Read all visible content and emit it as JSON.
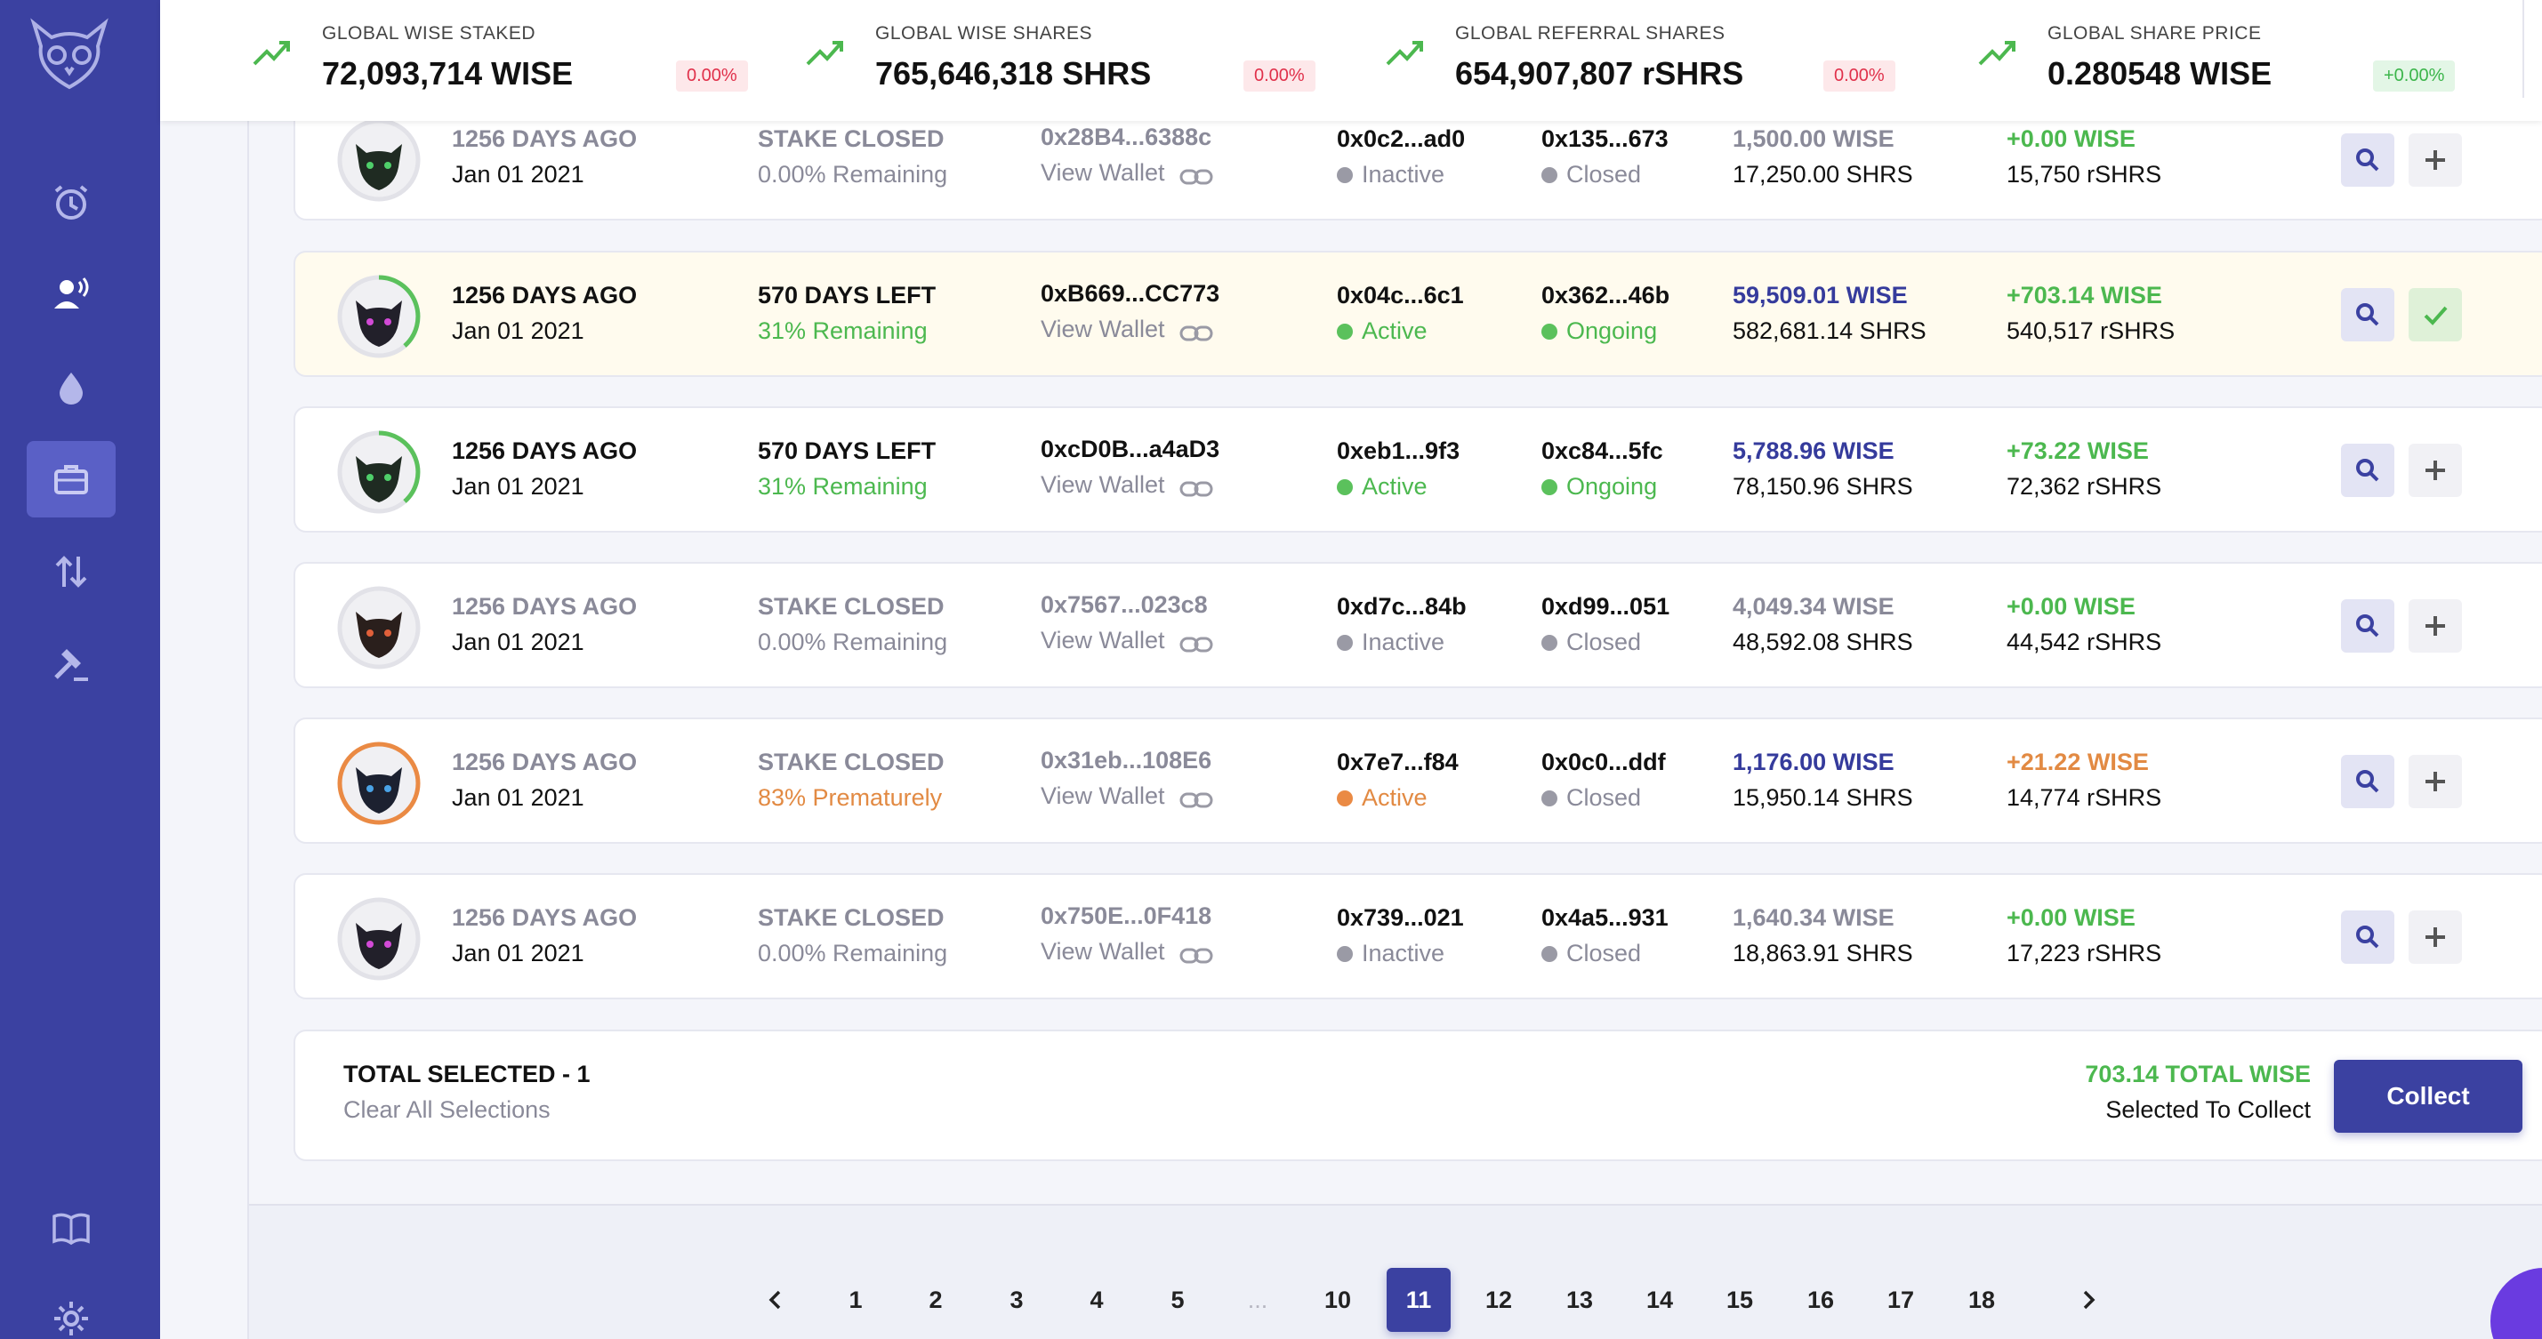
{
  "topbar": {
    "stats": [
      {
        "label": "GLOBAL WISE STAKED",
        "value": "72,093,714 WISE",
        "badge": "0.00%",
        "badge_color": "red"
      },
      {
        "label": "GLOBAL WISE SHARES",
        "value": "765,646,318 SHRS",
        "badge": "0.00%",
        "badge_color": "red"
      },
      {
        "label": "GLOBAL REFERRAL SHARES",
        "value": "654,907,807 rSHRS",
        "badge": "0.00%",
        "badge_color": "red"
      },
      {
        "label": "GLOBAL SHARE PRICE",
        "value": "0.280548 WISE",
        "badge": "+0.00%",
        "badge_color": "green"
      }
    ]
  },
  "sidebar": {
    "items": [
      {
        "icon": "alarm-clock-icon"
      },
      {
        "icon": "referral-voice-icon"
      },
      {
        "icon": "drop-icon"
      },
      {
        "icon": "briefcase-icon",
        "active": true
      },
      {
        "icon": "exchange-arrows-icon"
      },
      {
        "icon": "gavel-icon"
      },
      {
        "icon": "book-icon"
      },
      {
        "icon": "gear-icon"
      }
    ]
  },
  "rows": [
    {
      "ago": "1256 DAYS AGO",
      "date": "Jan 01 2021",
      "status": "STAKE CLOSED",
      "remaining": "0.00% Remaining",
      "wallet": "0x28B4...6388c",
      "wallet_link": "View Wallet",
      "ref": "0x0c2...ad0",
      "ref_state": "Inactive",
      "stake_id": "0x135...673",
      "stake_state": "Closed",
      "amount": "1,500.00 WISE",
      "shares": "17,250.00 SHRS",
      "reward": "+0.00 WISE",
      "rshares": "15,750 rSHRS"
    },
    {
      "ago": "1256 DAYS AGO",
      "date": "Jan 01 2021",
      "status": "570 DAYS LEFT",
      "remaining": "31% Remaining",
      "wallet": "0xB669...CC773",
      "wallet_link": "View Wallet",
      "ref": "0x04c...6c1",
      "ref_state": "Active",
      "stake_id": "0x362...46b",
      "stake_state": "Ongoing",
      "amount": "59,509.01 WISE",
      "shares": "582,681.14 SHRS",
      "reward": "+703.14 WISE",
      "rshares": "540,517 rSHRS"
    },
    {
      "ago": "1256 DAYS AGO",
      "date": "Jan 01 2021",
      "status": "570 DAYS LEFT",
      "remaining": "31% Remaining",
      "wallet": "0xcD0B...a4aD3",
      "wallet_link": "View Wallet",
      "ref": "0xeb1...9f3",
      "ref_state": "Active",
      "stake_id": "0xc84...5fc",
      "stake_state": "Ongoing",
      "amount": "5,788.96 WISE",
      "shares": "78,150.96 SHRS",
      "reward": "+73.22 WISE",
      "rshares": "72,362 rSHRS"
    },
    {
      "ago": "1256 DAYS AGO",
      "date": "Jan 01 2021",
      "status": "STAKE CLOSED",
      "remaining": "0.00% Remaining",
      "wallet": "0x7567...023c8",
      "wallet_link": "View Wallet",
      "ref": "0xd7c...84b",
      "ref_state": "Inactive",
      "stake_id": "0xd99...051",
      "stake_state": "Closed",
      "amount": "4,049.34 WISE",
      "shares": "48,592.08 SHRS",
      "reward": "+0.00 WISE",
      "rshares": "44,542 rSHRS"
    },
    {
      "ago": "1256 DAYS AGO",
      "date": "Jan 01 2021",
      "status": "STAKE CLOSED",
      "remaining": "83% Prematurely",
      "wallet": "0x31eb...108E6",
      "wallet_link": "View Wallet",
      "ref": "0x7e7...f84",
      "ref_state": "Active",
      "stake_id": "0x0c0...ddf",
      "stake_state": "Closed",
      "amount": "1,176.00 WISE",
      "shares": "15,950.14 SHRS",
      "reward": "+21.22 WISE",
      "rshares": "14,774 rSHRS"
    },
    {
      "ago": "1256 DAYS AGO",
      "date": "Jan 01 2021",
      "status": "STAKE CLOSED",
      "remaining": "0.00% Remaining",
      "wallet": "0x750E...0F418",
      "wallet_link": "View Wallet",
      "ref": "0x739...021",
      "ref_state": "Inactive",
      "stake_id": "0x4a5...931",
      "stake_state": "Closed",
      "amount": "1,640.34 WISE",
      "shares": "18,863.91 SHRS",
      "reward": "+0.00 WISE",
      "rshares": "17,223 rSHRS"
    }
  ],
  "footer": {
    "total_selected": "TOTAL SELECTED - 1",
    "clear": "Clear All Selections",
    "total": "703.14 TOTAL WISE",
    "total_sub": "Selected To Collect",
    "collect": "Collect"
  },
  "pagination": {
    "prev": "‹",
    "next": "›",
    "pages": [
      "1",
      "2",
      "3",
      "4",
      "5",
      "...",
      "10",
      "11",
      "12",
      "13",
      "14",
      "15",
      "16",
      "17",
      "18"
    ],
    "current": "11"
  },
  "colors": {
    "brand": "#3b41a1",
    "green": "#4cb84f",
    "orange": "#e28a43",
    "red": "#e0304a"
  }
}
